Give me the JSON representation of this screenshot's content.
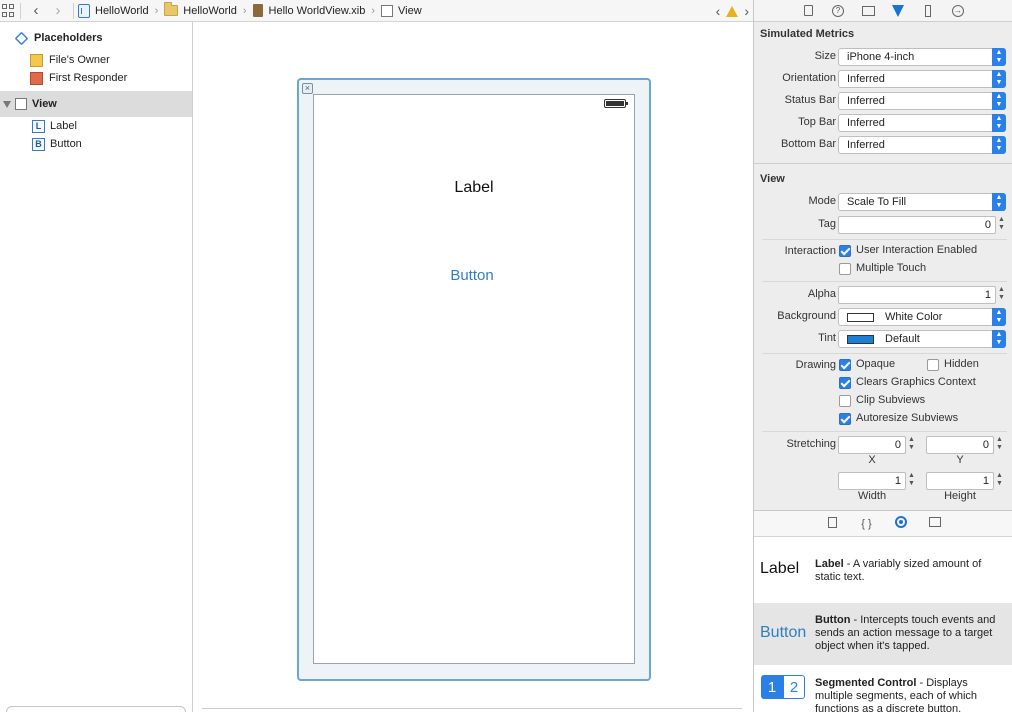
{
  "jumpbar": {
    "crumbs": [
      "HelloWorld",
      "HelloWorld",
      "Hello WorldView.xib",
      "View"
    ]
  },
  "outline": {
    "placeholders": "Placeholders",
    "files_owner": "File's Owner",
    "first_responder": "First Responder",
    "view": "View",
    "label_item": "Label",
    "label_badge": "L",
    "button_item": "Button",
    "button_badge": "B"
  },
  "canvas": {
    "label_text": "Label",
    "button_text": "Button"
  },
  "inspector": {
    "simulated_metrics": {
      "title": "Simulated Metrics",
      "size_label": "Size",
      "size_value": "iPhone 4-inch",
      "orientation_label": "Orientation",
      "orientation_value": "Inferred",
      "status_bar_label": "Status Bar",
      "status_bar_value": "Inferred",
      "top_bar_label": "Top Bar",
      "top_bar_value": "Inferred",
      "bottom_bar_label": "Bottom Bar",
      "bottom_bar_value": "Inferred"
    },
    "view": {
      "title": "View",
      "mode_label": "Mode",
      "mode_value": "Scale To Fill",
      "tag_label": "Tag",
      "tag_value": "0",
      "interaction_label": "Interaction",
      "user_interaction": "User Interaction Enabled",
      "multiple_touch": "Multiple Touch",
      "alpha_label": "Alpha",
      "alpha_value": "1",
      "background_label": "Background",
      "background_value": "White Color",
      "tint_label": "Tint",
      "tint_value": "Default",
      "drawing_label": "Drawing",
      "opaque": "Opaque",
      "hidden": "Hidden",
      "clears_graphics": "Clears Graphics Context",
      "clip_subviews": "Clip Subviews",
      "autoresize_subviews": "Autoresize Subviews",
      "stretching_label": "Stretching",
      "stretch_x": "0",
      "stretch_y": "0",
      "stretch_width": "1",
      "stretch_height": "1",
      "x_caption": "X",
      "y_caption": "Y",
      "width_caption": "Width",
      "height_caption": "Height"
    },
    "colors": {
      "background_swatch": "#ffffff",
      "tint_swatch": "#1b7fd6"
    }
  },
  "library": {
    "label_preview": "Label",
    "label_name": "Label",
    "label_desc": " - A variably sized amount of static text.",
    "button_preview": "Button",
    "button_name": "Button",
    "button_desc": " - Intercepts touch events and sends an action message to a target object when it's tapped.",
    "seg_1": "1",
    "seg_2": "2",
    "seg_name": "Segmented Control",
    "seg_desc": " - Displays multiple segments, each of which functions as a discrete button."
  }
}
